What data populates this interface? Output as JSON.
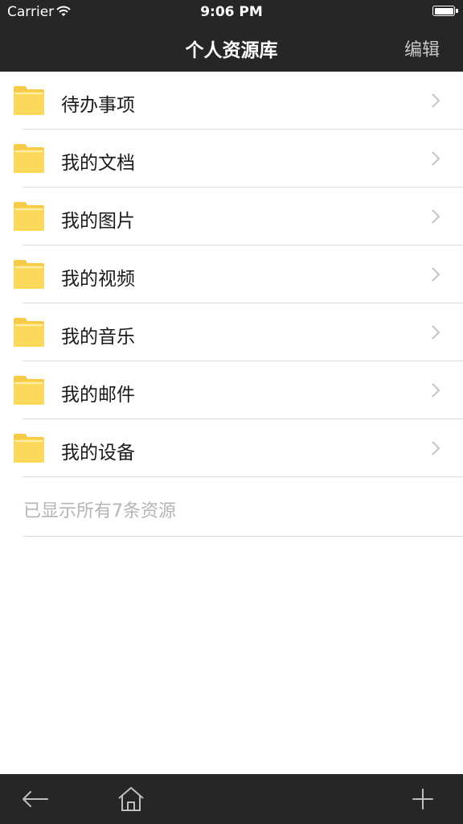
{
  "status_bar": {
    "carrier": "Carrier",
    "time": "9:06 PM"
  },
  "nav": {
    "title": "个人资源库",
    "edit_label": "编辑"
  },
  "list": {
    "items": [
      {
        "label": "待办事项",
        "icon": "folder-icon"
      },
      {
        "label": "我的文档",
        "icon": "folder-icon"
      },
      {
        "label": "我的图片",
        "icon": "folder-icon"
      },
      {
        "label": "我的视频",
        "icon": "folder-icon"
      },
      {
        "label": "我的音乐",
        "icon": "folder-icon"
      },
      {
        "label": "我的邮件",
        "icon": "folder-icon"
      },
      {
        "label": "我的设备",
        "icon": "folder-icon"
      }
    ],
    "footer_text": "已显示所有7条资源"
  },
  "toolbar": {
    "icons": [
      "back-arrow-icon",
      "home-icon",
      "plus-icon"
    ]
  },
  "colors": {
    "bar_bg": "#262626",
    "folder": "#fcd95c",
    "folder_tab": "#f6cc47",
    "separator": "#dcdcdc"
  }
}
